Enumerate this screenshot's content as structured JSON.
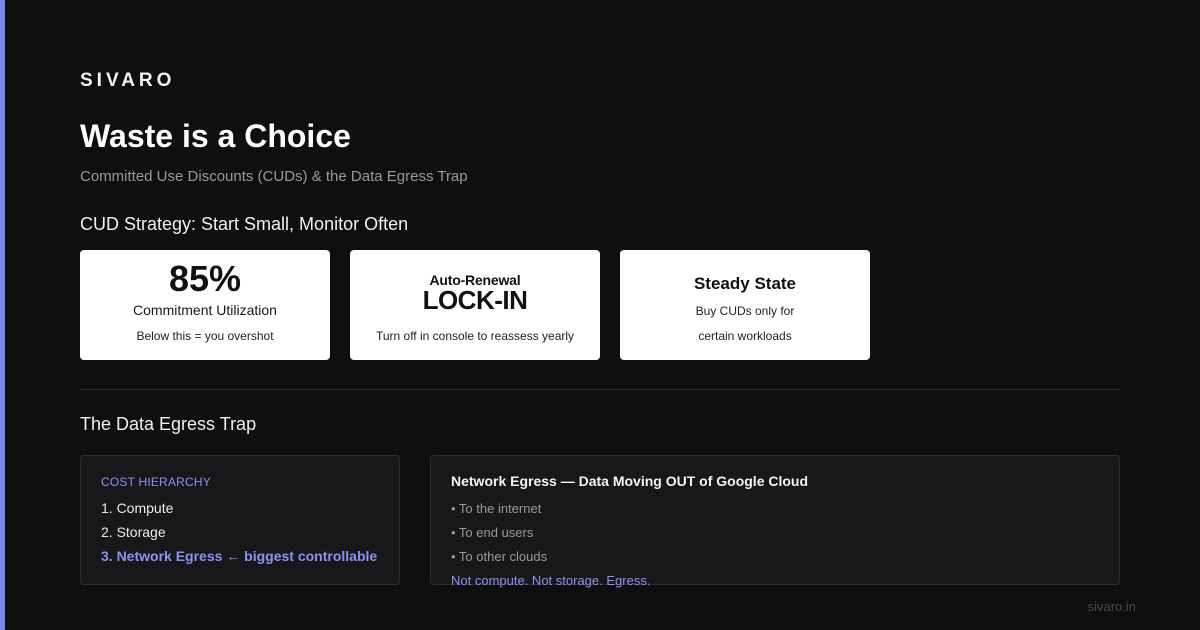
{
  "colors": {
    "background": "#0f0f0f",
    "accent": "#7b85f0",
    "card_background": "#ffffff",
    "panel_background": "#18181b"
  },
  "brand": "SIVARO",
  "title": "Waste is a Choice",
  "subtitle": "Committed Use Discounts (CUDs) & the Data Egress Trap",
  "cud_section": {
    "heading": "CUD Strategy: Start Small, Monitor Often",
    "cards": [
      {
        "value": "85%",
        "label": "Commitment Utilization",
        "note": "Below this = you overshot"
      },
      {
        "kicker": "Auto-Renewal",
        "value": "LOCK-IN",
        "note": "Turn off in console to reassess yearly"
      },
      {
        "title": "Steady State",
        "line1": "Buy CUDs only for",
        "line2": "certain workloads"
      }
    ]
  },
  "egress_section": {
    "heading": "The Data Egress Trap",
    "hierarchy": {
      "label": "COST HIERARCHY",
      "items": [
        "1. Compute",
        "2. Storage",
        "3. Network Egress ← biggest controllable"
      ]
    },
    "egress": {
      "title": "Network Egress — Data Moving OUT of Google Cloud",
      "items": [
        "• To the internet",
        "• To end users",
        "• To other clouds"
      ],
      "punchline": "Not compute. Not storage. Egress."
    }
  },
  "footer": "sivaro.in"
}
